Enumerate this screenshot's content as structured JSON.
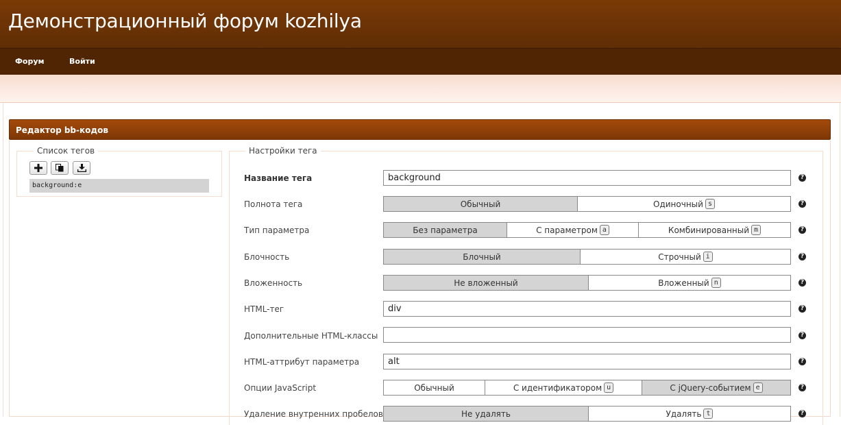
{
  "site": {
    "title": "Демонстрационный форум kozhilya"
  },
  "nav": {
    "items": [
      "Форум",
      "Войти"
    ]
  },
  "panel": {
    "title": "Редактор bb-кодов"
  },
  "tag_list": {
    "legend": "Список тегов",
    "tools": [
      "plus-icon",
      "copy-icon",
      "download-icon"
    ],
    "items": [
      "background:e"
    ]
  },
  "settings": {
    "legend": "Настройки тега",
    "name_label": "Название тега",
    "name_value": "background",
    "fullness": {
      "label": "Полнота тега",
      "options": [
        {
          "text": "Обычный",
          "key": ""
        },
        {
          "text": "Одиночный",
          "key": "s"
        }
      ],
      "selected": 0
    },
    "param_type": {
      "label": "Тип параметра",
      "options": [
        {
          "text": "Без параметра",
          "key": ""
        },
        {
          "text": "С параметром",
          "key": "a"
        },
        {
          "text": "Комбинированный",
          "key": "m"
        }
      ],
      "selected": 0
    },
    "block": {
      "label": "Блочность",
      "options": [
        {
          "text": "Блочный",
          "key": ""
        },
        {
          "text": "Строчный",
          "key": "i"
        }
      ],
      "selected": 0
    },
    "nesting": {
      "label": "Вложенность",
      "options": [
        {
          "text": "Не вложенный",
          "key": ""
        },
        {
          "text": "Вложенный",
          "key": "n"
        }
      ],
      "selected": 0
    },
    "html_tag": {
      "label": "HTML-тег",
      "value": "div"
    },
    "html_classes": {
      "label": "Дополнительные HTML-классы",
      "value": ""
    },
    "html_attr": {
      "label": "HTML-аттрибут параметра",
      "value": "alt"
    },
    "js_options": {
      "label": "Опции JavaScript",
      "options": [
        {
          "text": "Обычный",
          "key": ""
        },
        {
          "text": "С идентификатором",
          "key": "u"
        },
        {
          "text": "С jQuery-событием",
          "key": "e"
        }
      ],
      "selected": 2
    },
    "trim": {
      "label": "Удаление внутренних пробелов",
      "options": [
        {
          "text": "Не удалять",
          "key": ""
        },
        {
          "text": "Удалять",
          "key": "t"
        }
      ],
      "selected": 0
    }
  }
}
